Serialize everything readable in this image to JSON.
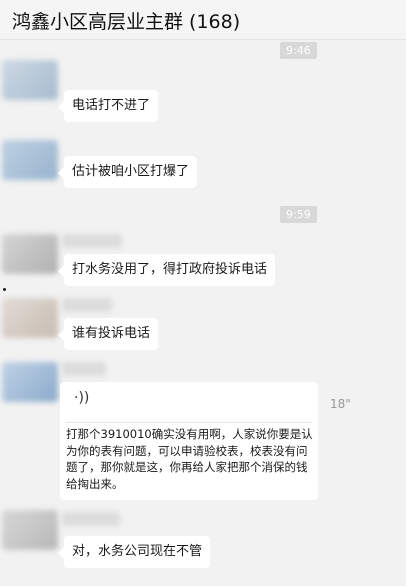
{
  "header": {
    "title": "鸿鑫小区高层业主群 (168)"
  },
  "timestamps": [
    "9:46",
    "9:59"
  ],
  "messages": [
    {
      "text": "电话打不进了"
    },
    {
      "text": "估计被咱小区打爆了"
    },
    {
      "text": "打水务没用了，得打政府投诉电话"
    },
    {
      "text": "谁有投诉电话"
    },
    {
      "voice_icon": "·))",
      "duration": "18\"",
      "transcript": "打那个3910010确实没有用啊，人家说你要是认为你的表有问题，可以申请验校表，校表没有问题了，那你就是这，你再给人家把那个消保的钱给掏出来。"
    },
    {
      "text": "对，水务公司现在不管"
    }
  ],
  "colors": {
    "background": "#f2f2f2",
    "bubble": "#ffffff",
    "timestamp_bg": "#d8d8d8"
  }
}
